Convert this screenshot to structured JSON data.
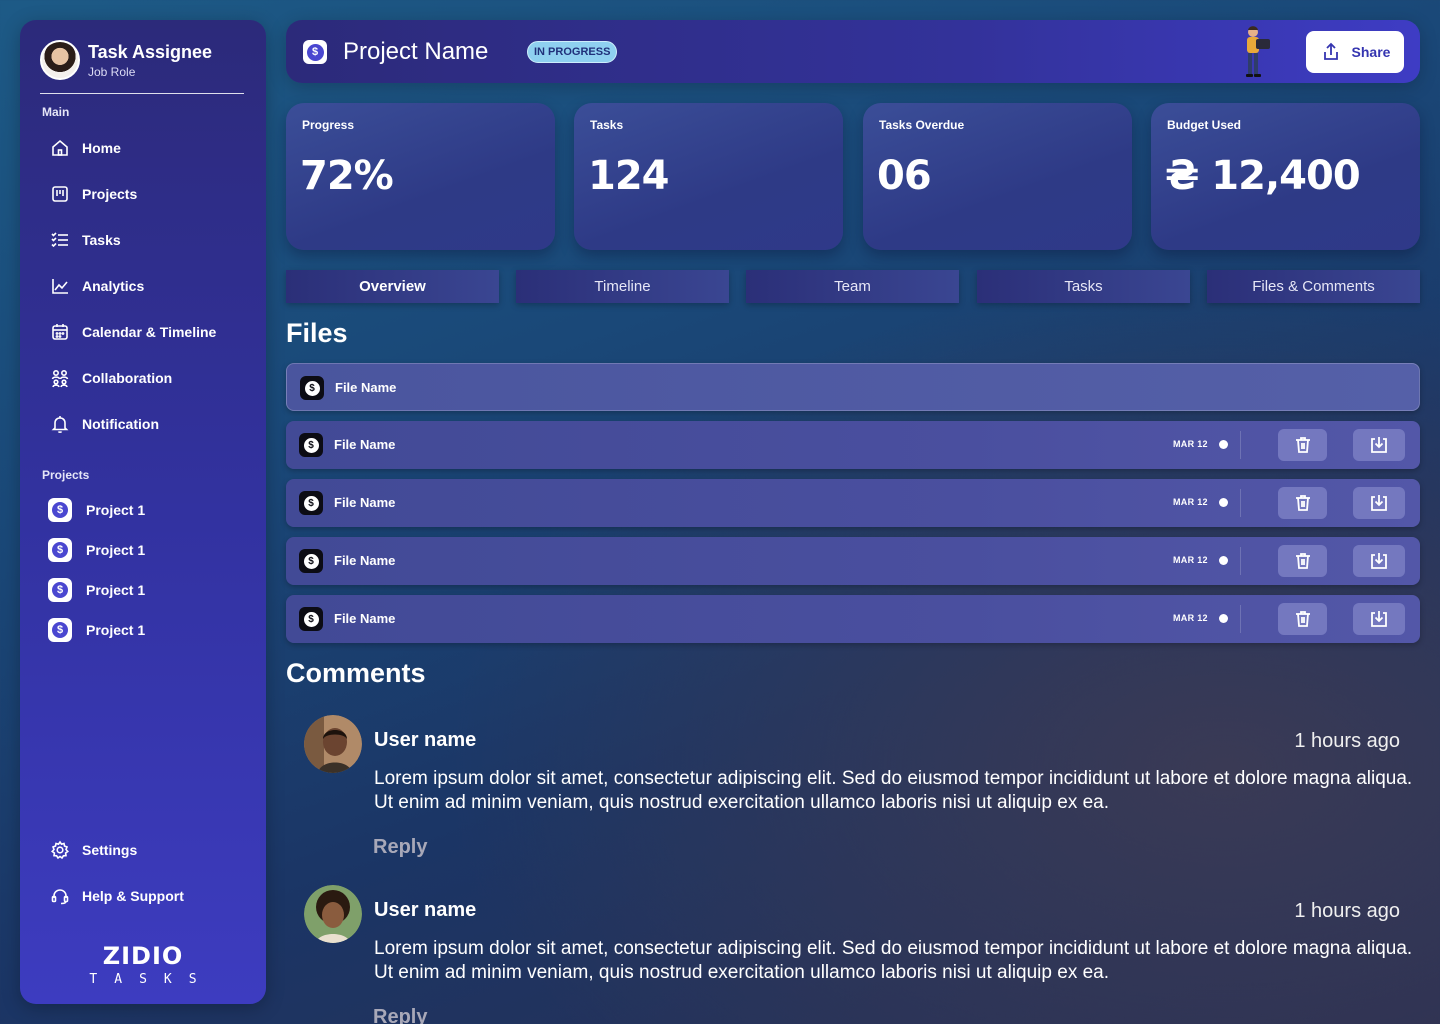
{
  "sidebar": {
    "profile": {
      "name": "Task Assignee",
      "role": "Job Role"
    },
    "main_label": "Main",
    "nav": [
      {
        "label": "Home",
        "icon": "home-icon"
      },
      {
        "label": "Projects",
        "icon": "projects-icon"
      },
      {
        "label": "Tasks",
        "icon": "tasks-icon"
      },
      {
        "label": "Analytics",
        "icon": "analytics-icon"
      },
      {
        "label": "Calendar & Timeline",
        "icon": "calendar-icon"
      },
      {
        "label": "Collaboration",
        "icon": "collaboration-icon"
      },
      {
        "label": "Notification",
        "icon": "bell-icon"
      }
    ],
    "projects_label": "Projects",
    "projects": [
      {
        "label": "Project 1"
      },
      {
        "label": "Project 1"
      },
      {
        "label": "Project 1"
      },
      {
        "label": "Project 1"
      }
    ],
    "settings_label": "Settings",
    "help_label": "Help & Support",
    "brand": {
      "top": "ZIDIO",
      "bottom": "TASKS"
    }
  },
  "header": {
    "title": "Project Name",
    "status": "IN PROGRESS",
    "share_label": "Share"
  },
  "stats": [
    {
      "label": "Progress",
      "value": "72%"
    },
    {
      "label": "Tasks",
      "value": "124"
    },
    {
      "label": "Tasks Overdue",
      "value": "06"
    },
    {
      "label": "Budget Used",
      "value": "₴ 12,400"
    }
  ],
  "tabs": [
    {
      "label": "Overview",
      "active": true
    },
    {
      "label": "Timeline",
      "active": false
    },
    {
      "label": "Team",
      "active": false
    },
    {
      "label": "Tasks",
      "active": false
    },
    {
      "label": "Files & Comments",
      "active": false
    }
  ],
  "files": {
    "title": "Files",
    "header_name": "File Name",
    "rows": [
      {
        "name": "File Name",
        "date": "MAR 12"
      },
      {
        "name": "File Name",
        "date": "MAR 12"
      },
      {
        "name": "File Name",
        "date": "MAR 12"
      },
      {
        "name": "File Name",
        "date": "MAR 12"
      }
    ]
  },
  "comments": {
    "title": "Comments",
    "items": [
      {
        "user": "User name",
        "time": "1 hours ago",
        "body": "Lorem ipsum dolor sit amet, consectetur adipiscing elit. Sed do eiusmod tempor incididunt ut labore et dolore magna aliqua. Ut enim ad minim veniam, quis nostrud exercitation ullamco laboris nisi ut aliquip ex ea.",
        "reply": "Reply"
      },
      {
        "user": "User name",
        "time": "1 hours ago",
        "body": "Lorem ipsum dolor sit amet, consectetur adipiscing elit. Sed do eiusmod tempor incididunt ut labore et dolore magna aliqua. Ut enim ad minim veniam, quis nostrud exercitation ullamco laboris nisi ut aliquip ex ea.",
        "reply": "Reply"
      }
    ]
  },
  "colors": {
    "accent": "#3d3cc0",
    "status_badge": "#8fd0f0",
    "file_button": "#7478bf"
  }
}
